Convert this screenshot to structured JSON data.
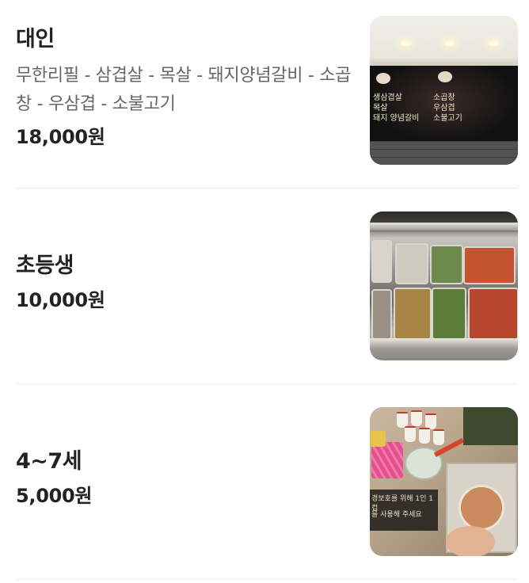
{
  "menu": {
    "items": [
      {
        "name": "대인",
        "description": "무한리필 - 삼겹살 - 목살 - 돼지양념갈비 - 소곱창 - 우삼겹 - 소불고기",
        "price": "18,000원",
        "image": "signboard-photo",
        "sign_text": {
          "left_1": "생삼겹살",
          "left_2": "목살",
          "left_3": "돼지 양념갈비",
          "mid_1": "소곱창",
          "mid_2": "우삼겹",
          "mid_3": "소불고기"
        }
      },
      {
        "name": "초등생",
        "price": "10,000원",
        "image": "buffet-trays-photo"
      },
      {
        "name": "4~7세",
        "price": "5,000원",
        "image": "sauce-bar-photo",
        "sign_text": {
          "line_1": "경보호를 위해 1인 1컵",
          "line_2": "을 사용해 주세요"
        }
      }
    ]
  }
}
